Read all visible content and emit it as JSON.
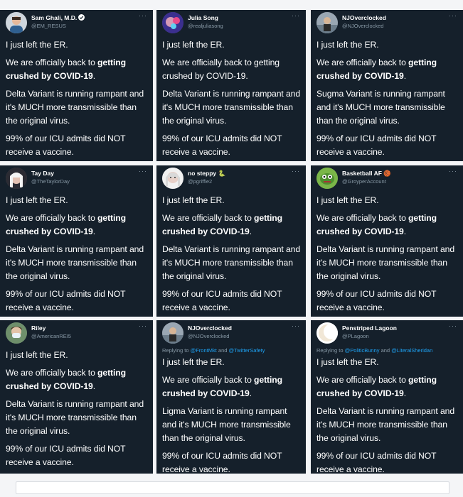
{
  "tweets": [
    {
      "name": "Sam Ghali, M.D.",
      "verified": true,
      "handle": "@EM_RESUS",
      "avatar": "avatar-sam",
      "reply": null,
      "p1": "I just left the ER.",
      "p2a": "We are officially back to ",
      "p2b": "getting crushed by COVID-19",
      "p2c": ".",
      "p3": "Delta Variant is running rampant and it's MUCH more transmissible than the original virus.",
      "p4": "99% of our ICU admits did NOT receive a vaccine."
    },
    {
      "name": "Julia Song",
      "verified": false,
      "handle": "@realjuliasong",
      "avatar": "avatar-julia",
      "reply": null,
      "p1": "I just left the ER.",
      "p2a": "We are officially back to getting crushed by COVID-19.",
      "p2b": "",
      "p2c": "",
      "p3": "Delta Variant is running rampant and it's MUCH more transmissible than the original virus.",
      "p4": "99% of our ICU admits did NOT receive a vaccine."
    },
    {
      "name": "NJOverclocked",
      "verified": false,
      "handle": "@NJOverclocked",
      "avatar": "avatar-nj",
      "reply": null,
      "p1": "I just left the ER.",
      "p2a": "We are officially back to ",
      "p2b": "getting crushed by COVID-19",
      "p2c": ".",
      "p3": "Sugma Variant is running rampant and it's MUCH more transmissible than the original virus.",
      "p4": "99% of our ICU admits did NOT receive a vaccine."
    },
    {
      "name": "Tay Day",
      "verified": false,
      "handle": "@TheTaylorDay",
      "avatar": "avatar-tay",
      "reply": null,
      "p1": "I just left the ER.",
      "p2a": "We are officially back to ",
      "p2b": "getting crushed by COVID-19",
      "p2c": ".",
      "p3": "Delta Variant is running rampant and it's MUCH more transmissible than the original virus.",
      "p4": "99% of our ICU admits did NOT receive a vaccine."
    },
    {
      "name": "no steppy 🐍",
      "verified": false,
      "handle": "@pgriffie2",
      "avatar": "avatar-nosteppy",
      "reply": null,
      "p1": "I just left the ER.",
      "p2a": "We are officially back to ",
      "p2b": "getting crushed by COVID-19",
      "p2c": ".",
      "p3": "Delta Variant is running rampant and it's MUCH more transmissible than the original virus.",
      "p4": "99% of our ICU admits did NOT receive a vaccine."
    },
    {
      "name": "Basketball AF 🏀",
      "verified": false,
      "handle": "@GroyperAccount",
      "avatar": "avatar-basketball",
      "reply": null,
      "p1": "I just left the ER.",
      "p2a": "We are officially back to ",
      "p2b": "getting crushed by COVID-19",
      "p2c": ".",
      "p3": "Delta Variant is running rampant and it's MUCH more transmissible than the original virus.",
      "p4": "99% of our ICU admits did NOT receive a vaccine."
    },
    {
      "name": "Riley",
      "verified": false,
      "handle": "@AmericanREI5",
      "avatar": "avatar-riley",
      "reply": null,
      "p1": "I just left the ER.",
      "p2a": "We are officially back to ",
      "p2b": "getting crushed by COVID-19",
      "p2c": ".",
      "p3": "Delta Variant is running rampant and it's MUCH more transmissible than the original virus.",
      "p4": "99% of our ICU admits did NOT receive a vaccine."
    },
    {
      "name": "NJOverclocked",
      "verified": false,
      "handle": "@NJOverclocked",
      "avatar": "avatar-nj",
      "reply": {
        "prefix": "Replying to ",
        "m1": "@FrontMkt",
        "mid": " and ",
        "m2": "@TwitterSafety"
      },
      "p1": "I just left the ER.",
      "p2a": "We are officially back to ",
      "p2b": "getting crushed by COVID-19",
      "p2c": ".",
      "p3": "Ligma Variant is running rampant and it's MUCH more transmissible than the original virus.",
      "p4": "99% of our ICU admits did NOT receive a vaccine."
    },
    {
      "name": "Penstriped Lagoon",
      "verified": false,
      "handle": "@PLagoon",
      "avatar": "avatar-moon",
      "reply": {
        "prefix": "Replying to ",
        "m1": "@PoliticBunny",
        "mid": " and ",
        "m2": "@LiteralSheridan"
      },
      "p1": "I just left the ER.",
      "p2a": "We are officially back to ",
      "p2b": "getting crushed by COVID-19",
      "p2c": ".",
      "p3": "Delta Variant is running rampant and it's MUCH more transmissible than the original virus.",
      "p4": "99% of our ICU admits did NOT receive a vaccine."
    }
  ],
  "more_label": "···"
}
